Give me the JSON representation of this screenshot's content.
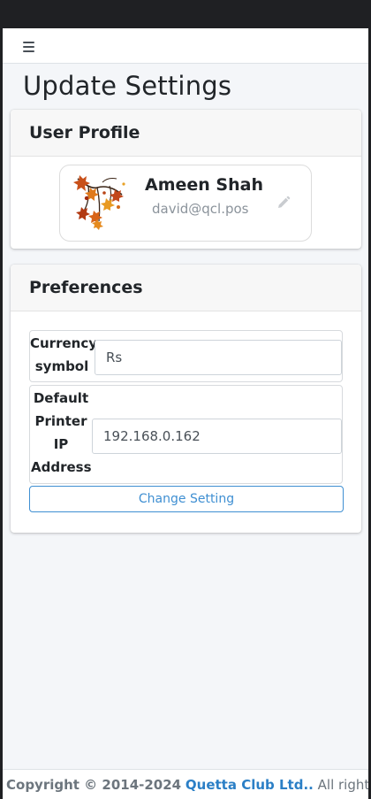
{
  "page": {
    "title": "Update Settings"
  },
  "navbar": {
    "menu_icon": "hamburger-menu-icon"
  },
  "user_profile_card": {
    "title": "User Profile",
    "name": "Ameen Shah",
    "email": "david@qcl.pos",
    "avatar_icon": "autumn-leaves-avatar-icon",
    "edit_icon": "pencil-icon"
  },
  "preferences_card": {
    "title": "Preferences",
    "currency": {
      "label": "Currency symbol",
      "value": "Rs"
    },
    "printer": {
      "label": "Default Printer IP Address",
      "value": "192.168.0.162"
    },
    "submit_label": "Change Setting"
  },
  "footer": {
    "copyright": "Copyright © 2014-2024",
    "company": "Quetta Club Ltd..",
    "rights": "All rights"
  },
  "colors": {
    "accent": "#3f8fd2",
    "page_bg": "#f4f6f9",
    "frame": "#1f2023"
  }
}
